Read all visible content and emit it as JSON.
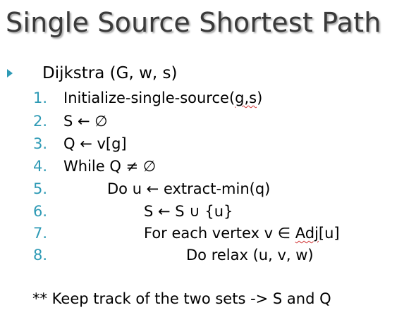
{
  "slide": {
    "title": "Single Source Shortest Path",
    "bullet": "Dijkstra (G, w, s)",
    "steps": [
      {
        "num": "1.",
        "text": "Initialize-single-source(",
        "mark": "g,s",
        "tail": ")"
      },
      {
        "num": "2.",
        "text": "S  ← ∅"
      },
      {
        "num": "3.",
        "text": "Q ← v[g]"
      },
      {
        "num": "4.",
        "text": "While Q ≠ ∅"
      },
      {
        "num": "5.",
        "text": "Do u ← extract-min(q)"
      },
      {
        "num": "6.",
        "text": "S ← S ∪ {u}"
      },
      {
        "num": "7.",
        "text": "For each vertex v ∈ ",
        "mark": "Adj",
        "tail": "[u]"
      },
      {
        "num": "8.",
        "text": "Do relax (u, v, w)"
      }
    ],
    "note": "** Keep track of the two sets -> S and Q"
  },
  "colors": {
    "accent": "#2e9ab5",
    "title": "#3a3a3a",
    "spellcheck": "#d03030"
  }
}
